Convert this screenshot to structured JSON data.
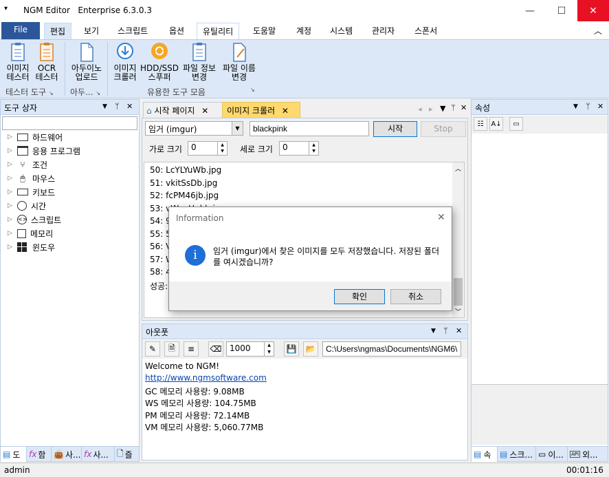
{
  "titlebar": {
    "title": "NGM Editor",
    "edition": "Enterprise 6.3.0.3",
    "menu_glyph": "▾",
    "minimize": "—",
    "maximize": "☐",
    "close": "✕"
  },
  "menu": {
    "file": "File",
    "tabs": [
      "편집",
      "보기",
      "스크립트",
      "옵션",
      "유틸리티",
      "도움말",
      "계정",
      "시스템",
      "관리자",
      "스폰서"
    ],
    "collapse": "︿"
  },
  "ribbon": {
    "buttons": [
      {
        "label1": "이미지",
        "label2": "테스터"
      },
      {
        "label1": "OCR",
        "label2": "테스터"
      },
      {
        "label1": "아두이노",
        "label2": "업로드"
      },
      {
        "label1": "이미지",
        "label2": "크롤러"
      },
      {
        "label1": "HDD/SSD",
        "label2": "스푸퍼"
      },
      {
        "label1": "파일 정보",
        "label2": "변경"
      },
      {
        "label1": "파일 이름",
        "label2": "변경"
      }
    ],
    "groups": [
      "테스터 도구",
      "아두...",
      "유용한 도구 모음"
    ]
  },
  "toolbox": {
    "title": "도구 상자",
    "search_value": "",
    "items": [
      "하드웨어",
      "응용 프로그램",
      "조건",
      "마우스",
      "키보드",
      "시간",
      "스크립트",
      "메모리",
      "윈도우"
    ],
    "bottom_tabs": [
      "도",
      "함",
      "사...",
      "사...",
      "즐"
    ]
  },
  "doctabs": {
    "tab1": "시작 페이지",
    "tab2": "이미지 크롤러",
    "close": "✕",
    "nav_left": "◂",
    "nav_right": "▸",
    "nav_down": "▾"
  },
  "crawler": {
    "source": "임거 (imgur)",
    "keyword": "blackpink",
    "start": "시작",
    "stop": "Stop",
    "width_label": "가로 크기",
    "width_value": "0",
    "height_label": "세로 크기",
    "height_value": "0",
    "lines": [
      "50: LcYLYuWb.jpg",
      "51: vkitSsDb.jpg",
      "52: fcPM46jb.jpg",
      "53: vWeeHebb.jpg",
      "54: 9o",
      "55: 5o",
      "56: Vo",
      "57: WE",
      "58: 48",
      "성공: 5"
    ]
  },
  "output": {
    "title": "아웃풋",
    "count": "1000",
    "path": "C:\\Users\\ngmas\\Documents\\NGM6\\",
    "lines": [
      "Welcome to NGM!",
      "http://www.ngmsoftware.com",
      "GC 메모리 사용량: 9.08MB",
      "WS 메모리 사용량: 104.75MB",
      "PM 메모리 사용량: 72.14MB",
      "VM 메모리 사용량: 5,060.77MB"
    ]
  },
  "properties": {
    "title": "속성",
    "bottom_tabs": [
      "속",
      "스크...",
      "이...",
      "외..."
    ]
  },
  "dialog": {
    "title": "Information",
    "message_line1": "임거 (imgur)에서 찾은 이미지를 모두 저장했습니다. 저장된 폴더",
    "message_line2": "를 여시겠습니까?",
    "ok": "확인",
    "cancel": "취소",
    "close": "✕",
    "icon_text": "i"
  },
  "statusbar": {
    "user": "admin",
    "time": "00:01:16"
  },
  "panel_controls": {
    "down": "▼",
    "pin": "ᛘ",
    "close": "✕"
  },
  "colors": {
    "accent": "#2b579a",
    "active_tab": "#ffd86e",
    "ribbon": "#dce8f7",
    "info_icon": "#1e6fd6",
    "close_red": "#e81123"
  }
}
